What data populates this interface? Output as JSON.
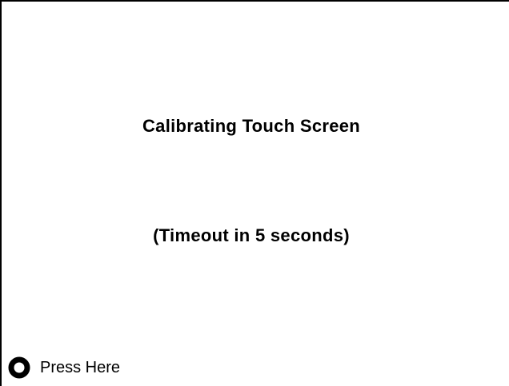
{
  "screen": {
    "title": "Calibrating Touch Screen",
    "timeout_text": "(Timeout in 5 seconds)"
  },
  "target": {
    "label": "Press Here",
    "icon": "calibration-target-icon"
  }
}
